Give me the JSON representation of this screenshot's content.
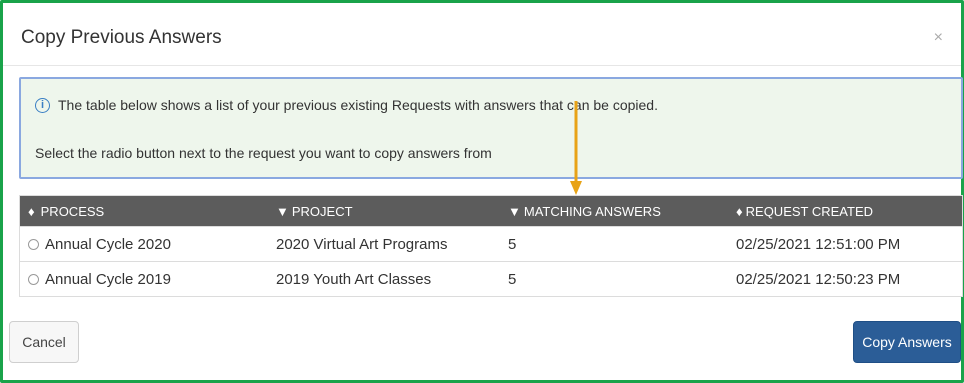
{
  "dialog": {
    "title": "Copy Previous Answers",
    "close_label": "×"
  },
  "info": {
    "icon": "info-circle-icon",
    "icon_glyph": "i",
    "line1": "The table below shows a list of your previous existing Requests with answers that can be copied.",
    "line2": "Select the radio button next to the request you want to copy answers from"
  },
  "table": {
    "columns": [
      {
        "label": "PROCESS",
        "sort_icon": "♦"
      },
      {
        "label": "PROJECT",
        "sort_icon": "▼"
      },
      {
        "label": "MATCHING ANSWERS",
        "sort_icon": "▼"
      },
      {
        "label": "REQUEST CREATED",
        "sort_icon": "♦"
      }
    ],
    "rows": [
      {
        "process": "Annual Cycle 2020",
        "project": "2020 Virtual Art Programs",
        "matching": "5",
        "created": "02/25/2021 12:51:00 PM",
        "selected": false
      },
      {
        "process": "Annual Cycle 2019",
        "project": "2019 Youth Art Classes",
        "matching": "5",
        "created": "02/25/2021 12:50:23 PM",
        "selected": false
      }
    ]
  },
  "buttons": {
    "cancel": "Cancel",
    "copy": "Copy Answers"
  },
  "colors": {
    "frame_border": "#19a34a",
    "info_bg": "#eef6ec",
    "info_border": "#8aa8e0",
    "table_header": "#5c5c5c",
    "primary_button": "#2b5d97",
    "annotation_arrow": "#e8a317"
  }
}
